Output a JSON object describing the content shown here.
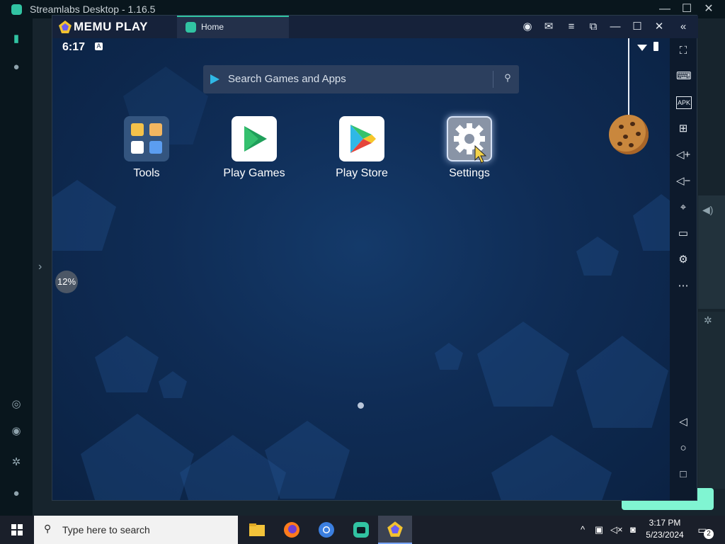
{
  "streamlabs": {
    "title": "Streamlabs Desktop - 1.16.5",
    "minimize": "—",
    "maximize": "☐",
    "close": "✕"
  },
  "memu": {
    "brand": "MEMU PLAY",
    "tab_label": "Home",
    "top_buttons": [
      "account-icon",
      "mail-icon",
      "menu-icon",
      "multi-window-icon",
      "minimize-icon",
      "maximize-icon",
      "close-icon",
      "collapse-icon"
    ]
  },
  "android": {
    "time": "6:17",
    "status_badge": "A",
    "search_placeholder": "Search Games and Apps",
    "apps": [
      {
        "label": "Tools"
      },
      {
        "label": "Play Games"
      },
      {
        "label": "Play Store"
      },
      {
        "label": "Settings"
      }
    ],
    "progress_text": "12%"
  },
  "toolbar": {
    "items": [
      "fullscreen-icon",
      "keyboard-icon",
      "apk-icon",
      "add-window-icon",
      "volume-up-icon",
      "volume-down-icon",
      "location-icon",
      "folder-icon",
      "settings-icon",
      "more-icon",
      "back-icon",
      "home-icon",
      "recents-icon"
    ],
    "apk_label": "APK"
  },
  "taskbar": {
    "search_placeholder": "Type here to search",
    "time": "3:17 PM",
    "date": "5/23/2024",
    "notification_count": "2"
  },
  "colors": {
    "accent": "#31c3a2",
    "screen_bg": "#0b2243",
    "golive": "#80f5d2"
  }
}
